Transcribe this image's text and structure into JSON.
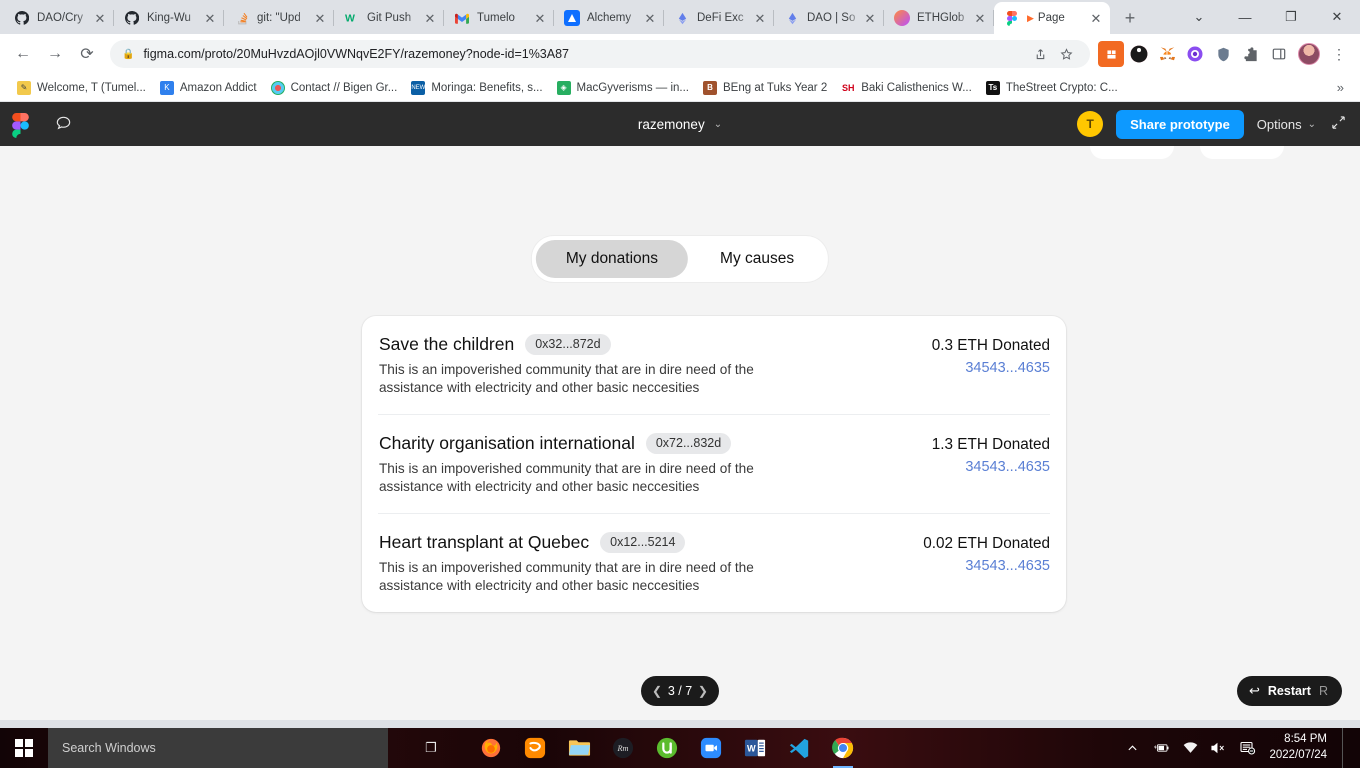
{
  "browser": {
    "tabs": [
      {
        "title": "DAO/Cry",
        "favicon": "github-icon",
        "active": false
      },
      {
        "title": "King-Wu",
        "favicon": "github-icon",
        "active": false
      },
      {
        "title": "git: \"Upd",
        "favicon": "stackoverflow-icon",
        "active": false
      },
      {
        "title": "Git Push",
        "favicon": "w3schools-icon",
        "active": false
      },
      {
        "title": "Tumelo",
        "favicon": "gmail-icon",
        "active": false
      },
      {
        "title": "Alchemy",
        "favicon": "alchemy-icon",
        "active": false
      },
      {
        "title": "DeFi Exc",
        "favicon": "defi-icon",
        "active": false
      },
      {
        "title": "DAO | So",
        "favicon": "defi-icon",
        "active": false
      },
      {
        "title": "ETHGlob",
        "favicon": "ethglobal-icon",
        "active": false
      },
      {
        "title": "Page",
        "favicon": "figma-icon",
        "active": true
      }
    ],
    "new_tab_label": "+",
    "window_controls": [
      "chevron-down-icon",
      "minimize-icon",
      "restore-icon",
      "close-icon"
    ],
    "nav": {
      "back": "←",
      "forward": "→",
      "reload": "⟳"
    },
    "url": "figma.com/proto/20MuHvzdAOjl0VWNqvE2FY/razemoney?node-id=1%3A87",
    "lock_icon": "lock-icon",
    "omnibox_icons": [
      "share-icon",
      "bookmark-star-icon"
    ],
    "extensions": [
      "grid-extension-icon",
      "pocket-icon",
      "metamask-icon",
      "brave-icon",
      "trust-wallet-icon",
      "puzzle-extensions-icon",
      "side-panel-icon"
    ],
    "profile": "avatar",
    "menu": "kebab-menu-icon",
    "bookmarks": [
      {
        "label": "Welcome, T (Tumel...",
        "favicon": "pencil-icon"
      },
      {
        "label": "Amazon Addict",
        "favicon": "blue-k-icon"
      },
      {
        "label": "Contact // Bigen Gr...",
        "favicon": "target-icon"
      },
      {
        "label": "Moringa: Benefits, s...",
        "favicon": "news-icon"
      },
      {
        "label": "MacGyverisms — in...",
        "favicon": "green-shield-icon"
      },
      {
        "label": "BEng at Tuks Year 2",
        "favicon": "b-icon"
      },
      {
        "label": "Baki Calisthenics W...",
        "favicon": "sh-icon"
      },
      {
        "label": "TheStreet Crypto: C...",
        "favicon": "ts-icon"
      }
    ],
    "bookmarks_overflow": "»"
  },
  "figma": {
    "logo": "figma-logo-icon",
    "comment_icon": "comment-icon",
    "file_name": "razemoney",
    "file_chevron": "chevron-down-icon",
    "avatar_initial": "T",
    "share_label": "Share prototype",
    "options_label": "Options",
    "options_chevron": "chevron-down-icon",
    "fullscreen_icon": "fullscreen-icon"
  },
  "prototype": {
    "tabs": [
      {
        "label": "My donations",
        "selected": true
      },
      {
        "label": "My causes",
        "selected": false
      }
    ],
    "donations": [
      {
        "title": "Save the children",
        "address": "0x32...872d",
        "description": "This is an impoverished community that are in dire need of the assistance with electricity and other basic neccesities",
        "amount": "0.3 ETH Donated",
        "tx": "34543...4635"
      },
      {
        "title": "Charity organisation international",
        "address": "0x72...832d",
        "description": "This is an impoverished community that are in dire need of the assistance with electricity and other basic neccesities",
        "amount": "1.3 ETH Donated",
        "tx": "34543...4635"
      },
      {
        "title": "Heart transplant at Quebec",
        "address": "0x12...5214",
        "description": "This is an impoverished community that are in dire need of the assistance with electricity and other basic neccesities",
        "amount": "0.02 ETH Donated",
        "tx": "34543...4635"
      }
    ],
    "pager": {
      "prev_icon": "chevron-left-icon",
      "label": "3 / 7",
      "next_icon": "chevron-right-icon"
    },
    "restart": {
      "icon": "restart-arrow-icon",
      "label": "Restart",
      "shortcut": "R"
    },
    "colors": {
      "accent": "#0d99ff",
      "link": "#5a7fd4",
      "page_bg": "#f4f4f4",
      "card_bg": "#ffffff",
      "chip_bg": "#e7e8ea",
      "toggle_active": "#d6d6d6"
    }
  },
  "taskbar": {
    "start_icon": "windows-start-icon",
    "search_placeholder": "Search Windows",
    "task_view_icon": "task-view-icon",
    "apps": [
      {
        "name": "firefox-icon"
      },
      {
        "name": "uc-browser-icon"
      },
      {
        "name": "file-explorer-icon"
      },
      {
        "name": "dark-logo-icon"
      },
      {
        "name": "utorrent-icon"
      },
      {
        "name": "zoom-icon"
      },
      {
        "name": "word-icon"
      },
      {
        "name": "vscode-icon"
      },
      {
        "name": "chrome-icon"
      }
    ],
    "tray": [
      "chevron-up-icon",
      "battery-charging-icon",
      "wifi-icon",
      "volume-muted-icon",
      "notifications-dnd-icon"
    ],
    "time": "8:54 PM",
    "date": "2022/07/24"
  }
}
